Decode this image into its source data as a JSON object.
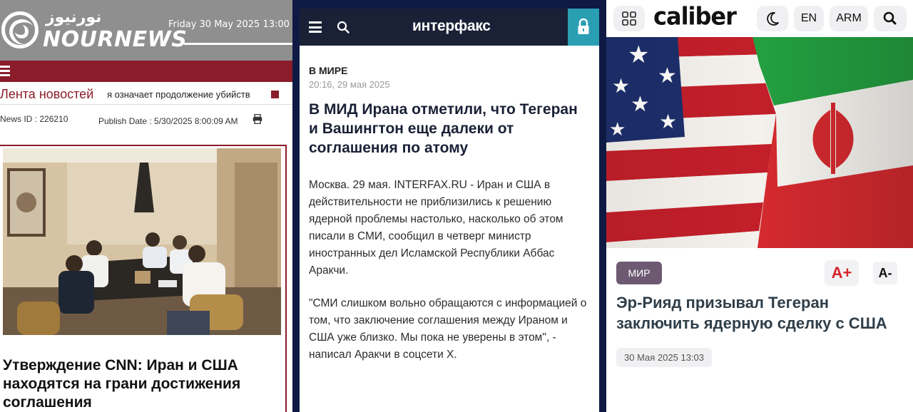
{
  "nournews": {
    "logo_fa": "نورنیوز",
    "logo_en": "NOURNEWS",
    "datetime": "Friday 30 May 2025 13:00",
    "ticker_label": "Лента новостей",
    "ticker_text": "я означает продолжение убийств",
    "news_id": "News ID : 226210",
    "publish_date": "Publish Date : 5/30/2025 8:00:09 AM",
    "headline": "Утверждение CNN: Иран и США находятся на грани достижения соглашения",
    "colors": {
      "header": "#8f8f8f",
      "accent": "#8b1c2a"
    }
  },
  "interfax": {
    "logo": "интерфакс",
    "category": "В МИРЕ",
    "timestamp": "20:16, 29 мая 2025",
    "title": "В МИД Ирана отметили, что Тегеран и Вашингтон еще далеки от соглашения по атому",
    "paragraph1": "Москва. 29 мая. INTERFAX.RU - Иран и США в действительности не приблизились к решению ядерной проблемы настолько, насколько об этом писали в СМИ, сообщил в четверг министр иностранных дел Исламской Республики Аббас Аракчи.",
    "paragraph2": "\"СМИ слишком вольно обращаются с информацией о том, что заключение соглашения между Ираном и США уже близко. Мы пока не уверены в этом\", - написал Аракчи в соцсети X.",
    "icons": {
      "menu": "hamburger-icon",
      "search": "search-icon",
      "lock": "lock-icon"
    },
    "colors": {
      "bar": "#1a2136",
      "lock_bg": "#2a9fb3"
    }
  },
  "caliber": {
    "logo": "caliber",
    "lang_en": "EN",
    "lang_arm": "ARM",
    "tag": "МИР",
    "font_increase": "A+",
    "font_decrease": "A-",
    "title": "Эр-Рияд призывал Тегеран заключить ядерную сделку с США",
    "date": "30 Мая 2025 13:03",
    "icons": {
      "grid": "grid-icon",
      "theme": "moon-icon",
      "search": "search-icon"
    },
    "colors": {
      "tag_bg": "#6d5a72",
      "font_increase": "#d6232a",
      "title": "#2f3e49"
    }
  }
}
